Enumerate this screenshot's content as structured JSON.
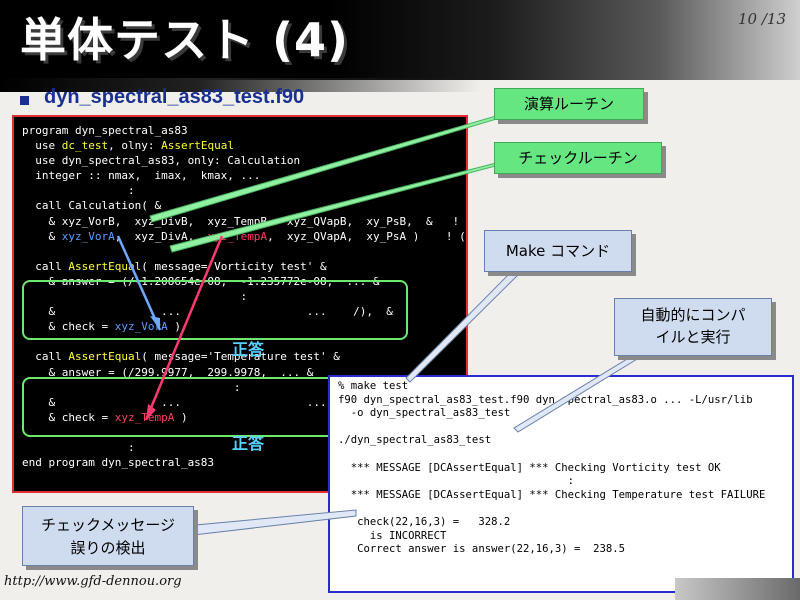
{
  "slide": {
    "title": "単体テスト (4)",
    "page_number": "10 /13",
    "subtitle": "dyn_spectral_as83_test.f90",
    "footer_url": "http://www.gfd-dennou.org"
  },
  "code_main": [
    [
      {
        "t": "program dyn_spectral_as83"
      }
    ],
    [
      {
        "t": "  use "
      },
      {
        "t": "dc_test",
        "c": "yellow"
      },
      {
        "t": ", olny: "
      },
      {
        "t": "AssertEqual",
        "c": "yellow"
      }
    ],
    [
      {
        "t": "  use dyn_spectral_as83, only: Calculation"
      }
    ],
    [
      {
        "t": "  integer :: nmax,  imax,  kmax, ..."
      }
    ],
    [
      {
        "t": "                :"
      }
    ],
    [
      {
        "t": "  call Calculation( &"
      }
    ],
    [
      {
        "t": "    & xyz_VorB,  xyz_DivB,  xyz_TempB,  xyz_QVapB,  xy_PsB,  &   ! (in)"
      }
    ],
    [
      {
        "t": "    & "
      },
      {
        "t": "xyz_VorA",
        "c": "blue"
      },
      {
        "t": ",  xyz_DivA,  "
      },
      {
        "t": "xyz_TempA",
        "c": "red"
      },
      {
        "t": ",  xyz_QVapA,  xy_PsA )    ! (out)"
      }
    ],
    [
      {
        "t": ""
      }
    ],
    [
      {
        "t": "  call "
      },
      {
        "t": "AssertEqual",
        "c": "yellow"
      },
      {
        "t": "( message='Vorticity test' &"
      }
    ],
    [
      {
        "t": "    & answer = (/-1.208654e-08,  -1.235772e-08,  ... &"
      }
    ],
    [
      {
        "t": "                                 :"
      }
    ],
    [
      {
        "t": "    &                ...                   ...    /),  &"
      }
    ],
    [
      {
        "t": "    & check = "
      },
      {
        "t": "xyz_VorA",
        "c": "blue"
      },
      {
        "t": " )"
      }
    ],
    [
      {
        "t": ""
      }
    ],
    [
      {
        "t": "  call "
      },
      {
        "t": "AssertEqual",
        "c": "yellow"
      },
      {
        "t": "( message='Temperature test' &"
      }
    ],
    [
      {
        "t": "    & answer = (/299.9977,  299.9978,  ... &"
      }
    ],
    [
      {
        "t": "                                :"
      }
    ],
    [
      {
        "t": "    &                ...                   ...    /),  &"
      }
    ],
    [
      {
        "t": "    & check = "
      },
      {
        "t": "xyz_TempA",
        "c": "red"
      },
      {
        "t": " )"
      }
    ],
    [
      {
        "t": ""
      }
    ],
    [
      {
        "t": "                :"
      }
    ],
    [
      {
        "t": "end program dyn_spectral_as83"
      }
    ]
  ],
  "code_terminal": [
    "% make test",
    "f90 dyn_spectral_as83_test.f90 dyn_spectral_as83.o ... -L/usr/lib",
    "  -o dyn_spectral_as83_test",
    "",
    "./dyn_spectral_as83_test",
    "",
    "  *** MESSAGE [DCAssertEqual] *** Checking Vorticity test OK",
    "                                    :",
    "  *** MESSAGE [DCAssertEqual] *** Checking Temperature test FAILURE",
    "",
    "   check(22,16,3) =   328.2",
    "     is INCORRECT",
    "   Correct answer is answer(22,16,3) =  238.5"
  ],
  "labels": {
    "correct_1": "正答",
    "correct_2": "正答",
    "callout_calc": "演算ルーチン",
    "callout_check": "チェックルーチン",
    "callout_make": "Make コマンド",
    "callout_auto_1": "自動的にコンパ",
    "callout_auto_2": "イルと実行",
    "callout_msg_1": "チェックメッセージ",
    "callout_msg_2": "誤りの検出"
  },
  "colors": {
    "code_bg": "#000000",
    "code_border": "#e03030",
    "keyword_yellow": "#ffff33",
    "variable_blue": "#5aa0ff",
    "variable_red": "#ff4060",
    "answer_box_green": "#6ee86e",
    "callout_green": "#66e680",
    "callout_blue": "#cfdcf0",
    "terminal_border": "#2a2ad0",
    "subtitle": "#1a3090"
  }
}
